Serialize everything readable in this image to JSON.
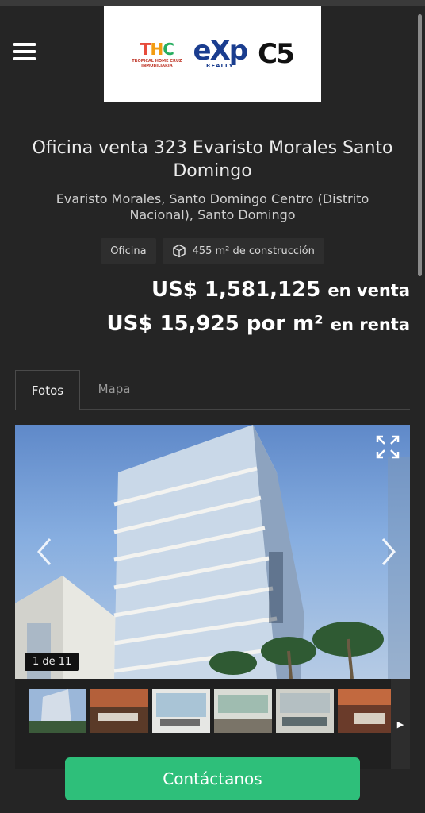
{
  "header": {
    "menu_icon": "hamburger-menu-icon",
    "logos": {
      "thc_mark": "THC",
      "thc_line1": "TROPICAL HOME CRUZ",
      "thc_line2": "INMOBILIARIA",
      "exp_mark": "eXp",
      "exp_sub": "REALTY",
      "c5_mark": "C5"
    }
  },
  "listing": {
    "title": "Oficina venta 323 Evaristo Morales Santo Domingo",
    "location": "Evaristo Morales, Santo Domingo Centro (Distrito Nacional), Santo Domingo",
    "chips": {
      "type": "Oficina",
      "area": "455 m² de construcción",
      "area_icon": "cube-icon"
    },
    "price_sale": {
      "amount": "US$ 1,581,125",
      "suffix": "en venta"
    },
    "price_rent": {
      "amount": "US$ 15,925 por m²",
      "suffix": "en renta"
    }
  },
  "tabs": [
    {
      "label": "Fotos",
      "active": true
    },
    {
      "label": "Mapa",
      "active": false
    }
  ],
  "gallery": {
    "counter": "1 de 11",
    "prev_icon": "chevron-left-icon",
    "next_icon": "chevron-right-icon",
    "expand_icon": "expand-icon",
    "thumbnail_count": 6,
    "strip_next_icon": "triangle-right-icon",
    "strip_next_glyph": "▶"
  },
  "cta": {
    "label": "Contáctanos"
  },
  "colors": {
    "background": "#252525",
    "cta": "#2ebf7a"
  }
}
